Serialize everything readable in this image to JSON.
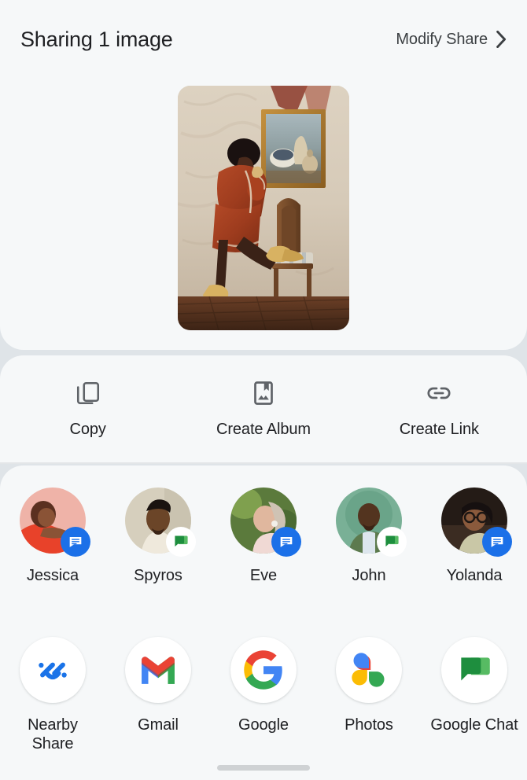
{
  "header": {
    "title": "Sharing 1 image",
    "modify_label": "Modify Share",
    "chevron_icon": "chevron-right-icon"
  },
  "preview": {
    "alt": "Person in rust coat leaning by a wall with framed still-life painting and wooden chair"
  },
  "actions": [
    {
      "label": "Copy",
      "icon": "copy-icon"
    },
    {
      "label": "Create Album",
      "icon": "album-icon"
    },
    {
      "label": "Create Link",
      "icon": "link-icon"
    }
  ],
  "contacts": [
    {
      "name": "Jessica",
      "badge": "messages-icon",
      "badge_type": "msg"
    },
    {
      "name": "Spyros",
      "badge": "google-chat-icon",
      "badge_type": "chat"
    },
    {
      "name": "Eve",
      "badge": "messages-icon",
      "badge_type": "msg"
    },
    {
      "name": "John",
      "badge": "google-chat-icon",
      "badge_type": "chat"
    },
    {
      "name": "Yolanda",
      "badge": "messages-icon",
      "badge_type": "msg"
    }
  ],
  "apps": [
    {
      "name": "Nearby Share",
      "icon": "nearby-share-icon"
    },
    {
      "name": "Gmail",
      "icon": "gmail-icon"
    },
    {
      "name": "Google",
      "icon": "google-icon"
    },
    {
      "name": "Photos",
      "icon": "google-photos-icon"
    },
    {
      "name": "Google Chat",
      "icon": "google-chat-icon"
    }
  ],
  "colors": {
    "sheet_bg": "#f6f8f9",
    "page_bg": "#dfe4e8",
    "text_primary": "#202124",
    "text_secondary": "#3c4043",
    "messages_blue": "#1b70e8",
    "chat_green": "#1e8e3e",
    "google_blue": "#4285f4",
    "google_red": "#ea4335",
    "google_yellow": "#fbbc04",
    "google_green": "#34a853",
    "nearby_blue": "#1a73e8"
  }
}
